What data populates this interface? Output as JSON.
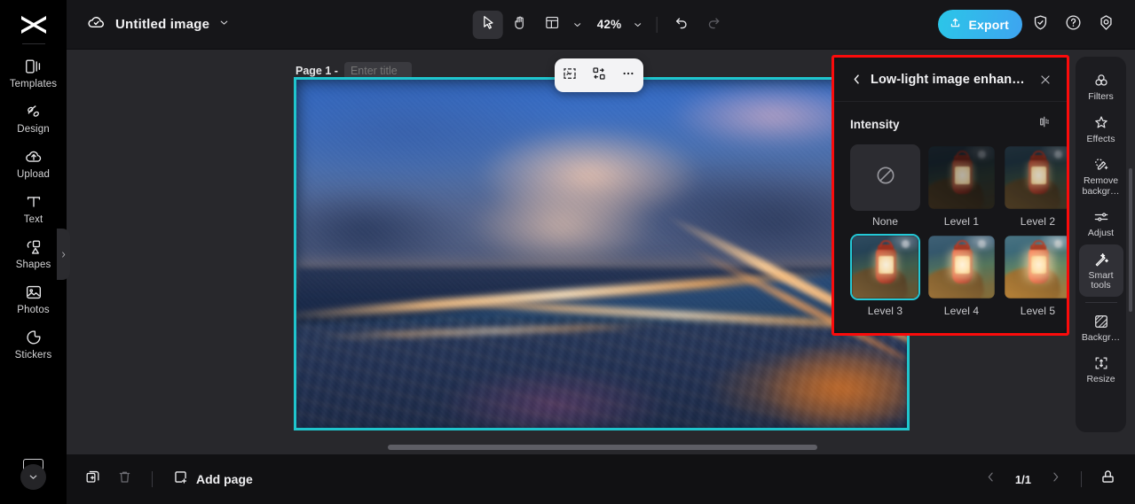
{
  "app": {
    "logo": "capcut-logo"
  },
  "left_rail": {
    "items": [
      {
        "label": "Templates",
        "icon": "templates-icon"
      },
      {
        "label": "Design",
        "icon": "design-icon"
      },
      {
        "label": "Upload",
        "icon": "upload-icon"
      },
      {
        "label": "Text",
        "icon": "text-icon"
      },
      {
        "label": "Shapes",
        "icon": "shapes-icon"
      },
      {
        "label": "Photos",
        "icon": "photos-icon"
      },
      {
        "label": "Stickers",
        "icon": "stickers-icon"
      }
    ],
    "collapse_icon": "chevron-down-icon",
    "expand_handle_icon": "chevron-right-icon"
  },
  "topbar": {
    "cloud_icon": "cloud-saved-icon",
    "doc_title": "Untitled image",
    "doc_menu_icon": "chevron-down-icon",
    "tools": {
      "select_icon": "cursor-select-icon",
      "hand_icon": "hand-pan-icon",
      "layout_icon": "layout-grid-icon",
      "layout_caret_icon": "chevron-down-icon",
      "zoom_value": "42%",
      "zoom_caret_icon": "chevron-down-icon",
      "undo_icon": "undo-icon",
      "redo_icon": "redo-icon"
    },
    "export_label": "Export",
    "export_icon": "export-upload-icon",
    "export_color": "#2bc6e8",
    "shield_icon": "shield-check-icon",
    "help_icon": "question-circle-icon",
    "settings_icon": "settings-gear-icon"
  },
  "canvas": {
    "page_label": "Page 1 -",
    "page_title_placeholder": "Enter title",
    "page_title_value": "",
    "selection_color": "#1fc5cd",
    "float_toolbar": {
      "crop_icon": "crop-image-icon",
      "replace_icon": "replace-swap-icon",
      "more_icon": "more-horizontal-icon"
    },
    "hscroll_name": "canvas-horizontal-scrollbar"
  },
  "side_panel": {
    "highlight_color": "#fb0b0b",
    "back_icon": "chevron-left-icon",
    "title": "Low-light image enhan…",
    "close_icon": "close-icon",
    "section_label": "Intensity",
    "compare_icon": "compare-split-icon",
    "selected_color": "#23c8d6",
    "options": [
      {
        "label": "None",
        "kind": "none",
        "selected": false
      },
      {
        "label": "Level 1",
        "kind": "preview",
        "selected": false
      },
      {
        "label": "Level 2",
        "kind": "preview",
        "selected": false
      },
      {
        "label": "Level 3",
        "kind": "preview",
        "selected": true
      },
      {
        "label": "Level 4",
        "kind": "preview",
        "selected": false
      },
      {
        "label": "Level 5",
        "kind": "preview",
        "selected": false
      }
    ]
  },
  "tool_rail": {
    "items": [
      {
        "label": "Filters",
        "icon": "filters-circles-icon",
        "active": false
      },
      {
        "label": "Effects",
        "icon": "effects-sparkle-icon",
        "active": false
      },
      {
        "label": "Remove\nbackgr…",
        "icon": "remove-background-icon",
        "active": false
      },
      {
        "label": "Adjust",
        "icon": "adjust-sliders-icon",
        "active": false
      },
      {
        "label": "Smart\ntools",
        "icon": "smart-tools-wand-icon",
        "active": true
      },
      {
        "label": "Backgr…",
        "icon": "background-icon",
        "active": false
      },
      {
        "label": "Resize",
        "icon": "resize-icon",
        "active": false
      }
    ]
  },
  "bottombar": {
    "duplicate_icon": "duplicate-page-icon",
    "delete_icon": "trash-delete-icon",
    "add_page_icon": "add-page-icon",
    "add_page_label": "Add page",
    "prev_icon": "chevron-left-icon",
    "page_count": "1/1",
    "next_icon": "chevron-right-icon",
    "notes_icon": "notes-panel-icon"
  }
}
